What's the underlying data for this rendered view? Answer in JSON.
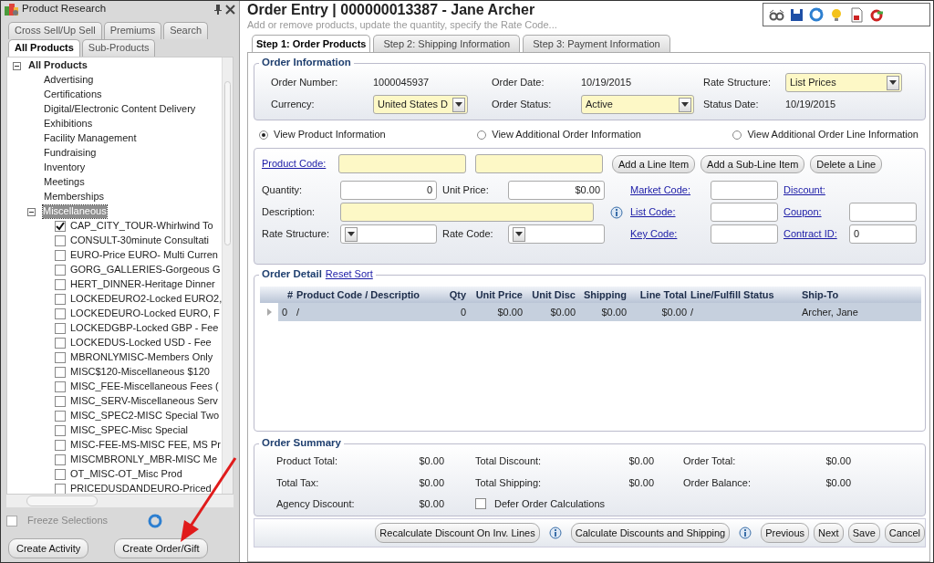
{
  "research_panel": {
    "title": "Product Research",
    "tab_rows": [
      [
        {
          "label": "Cross Sell/Up Sell",
          "selected": false
        },
        {
          "label": "Premiums",
          "selected": false
        },
        {
          "label": "Search",
          "selected": false
        }
      ],
      [
        {
          "label": "All Products",
          "selected": true
        },
        {
          "label": "Sub-Products",
          "selected": false
        }
      ]
    ],
    "tree": {
      "label": "All Products",
      "expanded": true,
      "children": [
        {
          "label": "Advertising"
        },
        {
          "label": "Certifications"
        },
        {
          "label": "Digital/Electronic Content Delivery"
        },
        {
          "label": "Exhibitions"
        },
        {
          "label": "Facility Management"
        },
        {
          "label": "Fundraising"
        },
        {
          "label": "Inventory"
        },
        {
          "label": "Meetings"
        },
        {
          "label": "Memberships"
        },
        {
          "label": "Miscellaneous",
          "expanded": true,
          "selected": true,
          "children": [
            {
              "label": "CAP_CITY_TOUR-Whirlwind To",
              "checked": true
            },
            {
              "label": "CONSULT-30minute Consultati",
              "checked": false
            },
            {
              "label": "EURO-Price EURO- Multi Curren",
              "checked": false
            },
            {
              "label": "GORG_GALLERIES-Gorgeous G",
              "checked": false
            },
            {
              "label": "HERT_DINNER-Heritage Dinner",
              "checked": false
            },
            {
              "label": "LOCKEDEURO2-Locked EURO2,",
              "checked": false
            },
            {
              "label": "LOCKEDEURO-Locked EURO, F",
              "checked": false
            },
            {
              "label": "LOCKEDGBP-Locked GBP - Fee",
              "checked": false
            },
            {
              "label": "LOCKEDUS-Locked USD - Fee",
              "checked": false
            },
            {
              "label": "MBRONLYMISC-Members Only",
              "checked": false
            },
            {
              "label": "MISC$120-Miscellaneous $120",
              "checked": false
            },
            {
              "label": "MISC_FEE-Miscellaneous Fees (",
              "checked": false
            },
            {
              "label": "MISC_SERV-Miscellaneous Serv",
              "checked": false
            },
            {
              "label": "MISC_SPEC2-MISC Special Two",
              "checked": false
            },
            {
              "label": "MISC_SPEC-Misc Special",
              "checked": false
            },
            {
              "label": "MISC-FEE-MS-MISC FEE, MS Pr",
              "checked": false
            },
            {
              "label": "MISCMBRONLY_MBR-MISC Me",
              "checked": false
            },
            {
              "label": "OT_MISC-OT_Misc Prod",
              "checked": false
            },
            {
              "label": "PRICEDUSDANDEURO-Priced",
              "checked": false
            }
          ]
        }
      ]
    },
    "freeze": {
      "label": "Freeze Selections",
      "checked": false,
      "disabled": true
    },
    "buttons": [
      "Create Activity",
      "Create Order/Gift"
    ]
  },
  "order_entry": {
    "title": "Order Entry | 000000013387 - Jane Archer",
    "subtitle": "Add or remove products, update the quantity, specify the Rate Code...",
    "step_tabs": [
      {
        "label": "Step 1: Order Products",
        "selected": true
      },
      {
        "label": "Step 2: Shipping Information",
        "selected": false
      },
      {
        "label": "Step 3: Payment Information",
        "selected": false
      }
    ],
    "order_information": {
      "legend": "Order Information",
      "fields": [
        {
          "label": "Order Number:",
          "value": "1000045937",
          "kind": "text"
        },
        {
          "label": "Order Date:",
          "value": "10/19/2015",
          "kind": "text"
        },
        {
          "label": "Rate Structure:",
          "value": "List Prices",
          "kind": "select"
        },
        {
          "label": "Currency:",
          "value": "United States D",
          "kind": "select"
        },
        {
          "label": "Order Status:",
          "value": "Active",
          "kind": "select"
        },
        {
          "label": "Status Date:",
          "value": "10/19/2015",
          "kind": "text"
        }
      ]
    },
    "view_options": [
      {
        "label": "View Product Information",
        "selected": true
      },
      {
        "label": "View Additional Order Information",
        "selected": false
      },
      {
        "label": "View Additional Order Line Information",
        "selected": false
      }
    ],
    "product": {
      "product_code_label": "Product Code:",
      "line_buttons": [
        "Add a Line Item",
        "Add a Sub-Line Item",
        "Delete a Line"
      ],
      "quantity_label": "Quantity:",
      "quantity": "0",
      "unit_price_label": "Unit Price:",
      "unit_price": "$0.00",
      "description_label": "Description:",
      "rate_structure_label": "Rate Structure:",
      "rate_code_label": "Rate Code:",
      "links": [
        {
          "label": "Market Code:"
        },
        {
          "label": "Discount:"
        },
        {
          "label": "List Code:"
        },
        {
          "label": "Coupon:"
        },
        {
          "label": "Key Code:"
        },
        {
          "label": "Contract ID:",
          "value": "0"
        }
      ]
    },
    "order_detail": {
      "legend": "Order Detail",
      "reset_link": "Reset Sort",
      "columns": [
        "#",
        "Product Code / Descriptio",
        "Qty",
        "Unit Price",
        "Unit Disc",
        "Shipping",
        "Line Total",
        "Line/Fulfill Status",
        "Ship-To"
      ],
      "rows": [
        {
          "cells": [
            "0",
            "/",
            "0",
            "$0.00",
            "$0.00",
            "$0.00",
            "$0.00",
            "/",
            "Archer, Jane"
          ],
          "selected": true
        }
      ]
    },
    "order_summary": {
      "legend": "Order Summary",
      "items": [
        {
          "label": "Product Total:",
          "value": "$0.00"
        },
        {
          "label": "Total Discount:",
          "value": "$0.00"
        },
        {
          "label": "Order Total:",
          "value": "$0.00"
        },
        {
          "label": "Total Tax:",
          "value": "$0.00"
        },
        {
          "label": "Total Shipping:",
          "value": "$0.00"
        },
        {
          "label": "Order Balance:",
          "value": "$0.00"
        },
        {
          "label": "Agency Discount:",
          "value": "$0.00"
        }
      ],
      "defer": {
        "label": "Defer Order Calculations",
        "checked": false
      }
    },
    "action_buttons": [
      {
        "label": "Recalculate Discount On Inv. Lines",
        "kind": "info"
      },
      {
        "label": "Calculate Discounts and Shipping",
        "kind": "info"
      },
      {
        "label": "Previous",
        "kind": "plain"
      },
      {
        "label": "Next",
        "kind": "plain"
      },
      {
        "label": "Save",
        "kind": "plain"
      },
      {
        "label": "Cancel",
        "kind": "plain"
      }
    ]
  }
}
